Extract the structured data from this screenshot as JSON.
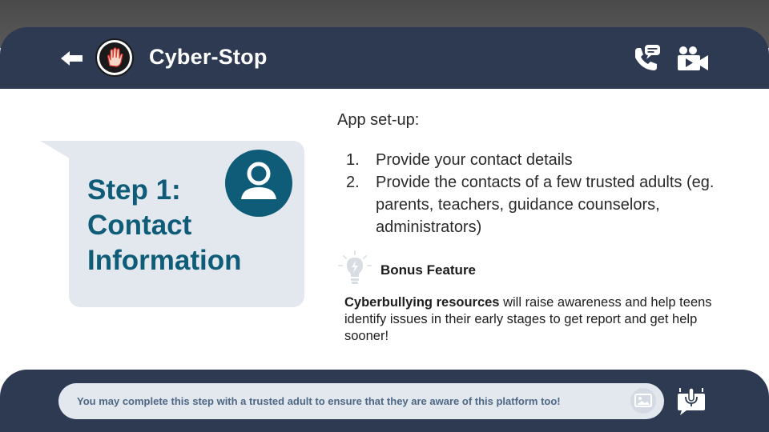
{
  "header": {
    "app_title": "Cyber-Stop",
    "icons": {
      "back": "back-arrow-icon",
      "logo": "stop-hand-logo-icon",
      "call": "phone-call-message-icon",
      "video": "video-camera-icon"
    }
  },
  "step_card": {
    "title_line1": "Step 1:",
    "title_line2": "Contact",
    "title_line3": "Information",
    "icon": "user-avatar-icon"
  },
  "setup": {
    "heading": "App set-up:",
    "items": [
      {
        "num": "1.",
        "text": "Provide your contact details"
      },
      {
        "num": "2.",
        "text": "Provide the contacts of a few trusted adults (eg. parents, teachers, guidance counselors, administrators)"
      }
    ]
  },
  "bonus": {
    "icon": "lightbulb-icon",
    "title": "Bonus Feature",
    "bold_text": "Cyberbullying resources",
    "rest_text": " will raise awareness and help teens identify issues in their early stages to get report and get help sooner!"
  },
  "footer": {
    "message": "You may complete this step with a trusted adult to ensure that they are aware of this platform too!",
    "icons": {
      "image": "image-icon",
      "mic": "microphone-icon"
    }
  },
  "colors": {
    "navy": "#2d3a52",
    "teal": "#0f5c78",
    "card": "#e3e8ef",
    "footer_text": "#4d6785"
  }
}
